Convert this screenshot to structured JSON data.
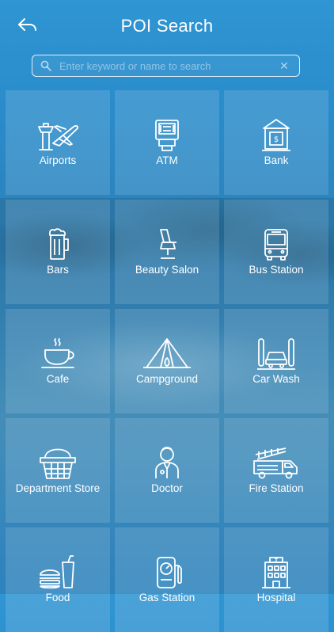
{
  "header": {
    "title": "POI Search",
    "back_icon": "back-arrow-icon"
  },
  "search": {
    "placeholder": "Enter keyword or name to search",
    "value": "",
    "search_icon": "search-icon",
    "clear_icon": "clear-icon",
    "clear_glyph": "✕"
  },
  "categories": [
    {
      "label": "Airports",
      "icon": "airport-icon"
    },
    {
      "label": "ATM",
      "icon": "atm-icon"
    },
    {
      "label": "Bank",
      "icon": "bank-icon"
    },
    {
      "label": "Bars",
      "icon": "beer-icon"
    },
    {
      "label": "Beauty Salon",
      "icon": "salon-chair-icon"
    },
    {
      "label": "Bus Station",
      "icon": "bus-icon"
    },
    {
      "label": "Cafe",
      "icon": "coffee-cup-icon"
    },
    {
      "label": "Campground",
      "icon": "tent-icon"
    },
    {
      "label": "Car Wash",
      "icon": "car-wash-icon"
    },
    {
      "label": "Department Store",
      "icon": "shopping-basket-icon"
    },
    {
      "label": "Doctor",
      "icon": "doctor-icon"
    },
    {
      "label": "Fire Station",
      "icon": "fire-truck-icon"
    },
    {
      "label": "Food",
      "icon": "fast-food-icon"
    },
    {
      "label": "Gas Station",
      "icon": "gas-pump-icon"
    },
    {
      "label": "Hospital",
      "icon": "hospital-icon"
    }
  ],
  "colors": {
    "background": "#2a8ccb",
    "tile": "rgba(255,255,255,0.13)",
    "text": "#ffffff"
  }
}
